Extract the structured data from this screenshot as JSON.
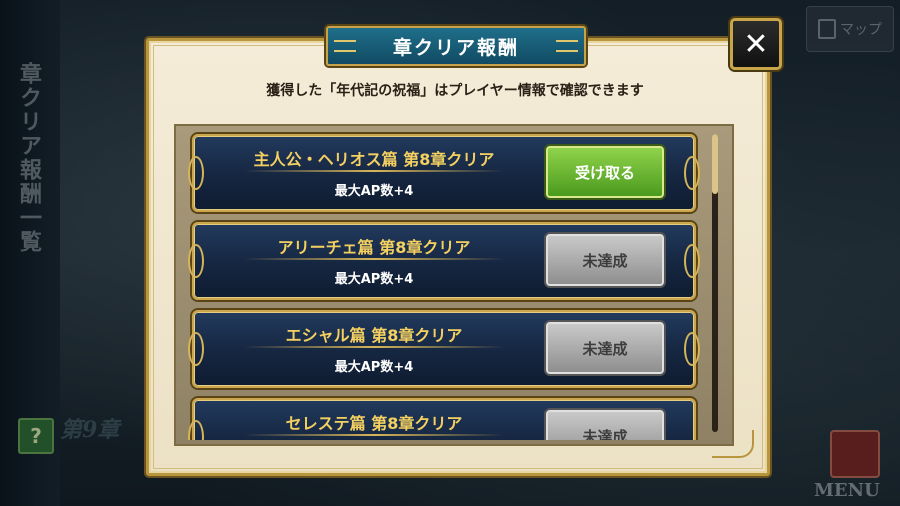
{
  "background": {
    "side_title": "章クリア報酬一覧",
    "help_icon": "?",
    "chapter_label": "第9章",
    "map_button": "マップ",
    "menu_button": "MENU"
  },
  "dialog": {
    "title": "章クリア報酬",
    "close_icon": "✕",
    "subtitle": "獲得した「年代記の祝福」はプレイヤー情報で確認できます",
    "rewards": [
      {
        "title": "主人公・ヘリオス篇 第8章クリア",
        "reward": "最大AP数+4",
        "button": "受け取る",
        "status": "claimable"
      },
      {
        "title": "アリーチェ篇 第8章クリア",
        "reward": "最大AP数+4",
        "button": "未達成",
        "status": "locked"
      },
      {
        "title": "エシャル篇 第8章クリア",
        "reward": "最大AP数+4",
        "button": "未達成",
        "status": "locked"
      },
      {
        "title": "セレステ篇 第8章クリア",
        "reward": "",
        "button": "未達成",
        "status": "locked"
      }
    ]
  },
  "colors": {
    "accent_gold": "#caa64c",
    "claim_green": "#4b9a1e",
    "locked_gray": "#8e8e8e",
    "title_teal": "#1f6f8a"
  }
}
